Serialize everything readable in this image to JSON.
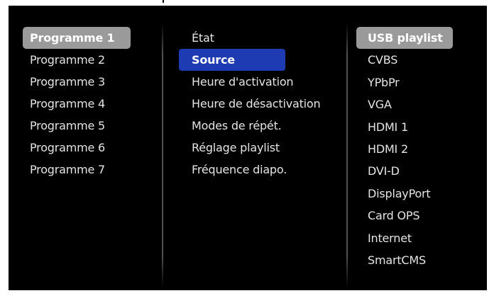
{
  "programmes": [
    {
      "label": "Programme 1",
      "selected": true
    },
    {
      "label": "Programme 2"
    },
    {
      "label": "Programme 3"
    },
    {
      "label": "Programme 4"
    },
    {
      "label": "Programme 5"
    },
    {
      "label": "Programme 6"
    },
    {
      "label": "Programme 7"
    }
  ],
  "menu": [
    {
      "label": "État"
    },
    {
      "label": "Source",
      "highlighted": true
    },
    {
      "label": "Heure d'activation"
    },
    {
      "label": "Heure de désactivation"
    },
    {
      "label": "Modes de répét."
    },
    {
      "label": "Réglage playlist"
    },
    {
      "label": "Fréquence diapo."
    }
  ],
  "sources": [
    {
      "label": "USB playlist",
      "selected": true
    },
    {
      "label": "CVBS"
    },
    {
      "label": "YPbPr"
    },
    {
      "label": "VGA"
    },
    {
      "label": "HDMI 1"
    },
    {
      "label": "HDMI 2"
    },
    {
      "label": "DVI-D"
    },
    {
      "label": "DisplayPort"
    },
    {
      "label": "Card OPS"
    },
    {
      "label": "Internet"
    },
    {
      "label": "SmartCMS"
    }
  ],
  "colors": {
    "background": "#000000",
    "text": "#e4e4e4",
    "selected_gray": "#9a9a9a",
    "highlight_blue": "#1f3bb4"
  }
}
